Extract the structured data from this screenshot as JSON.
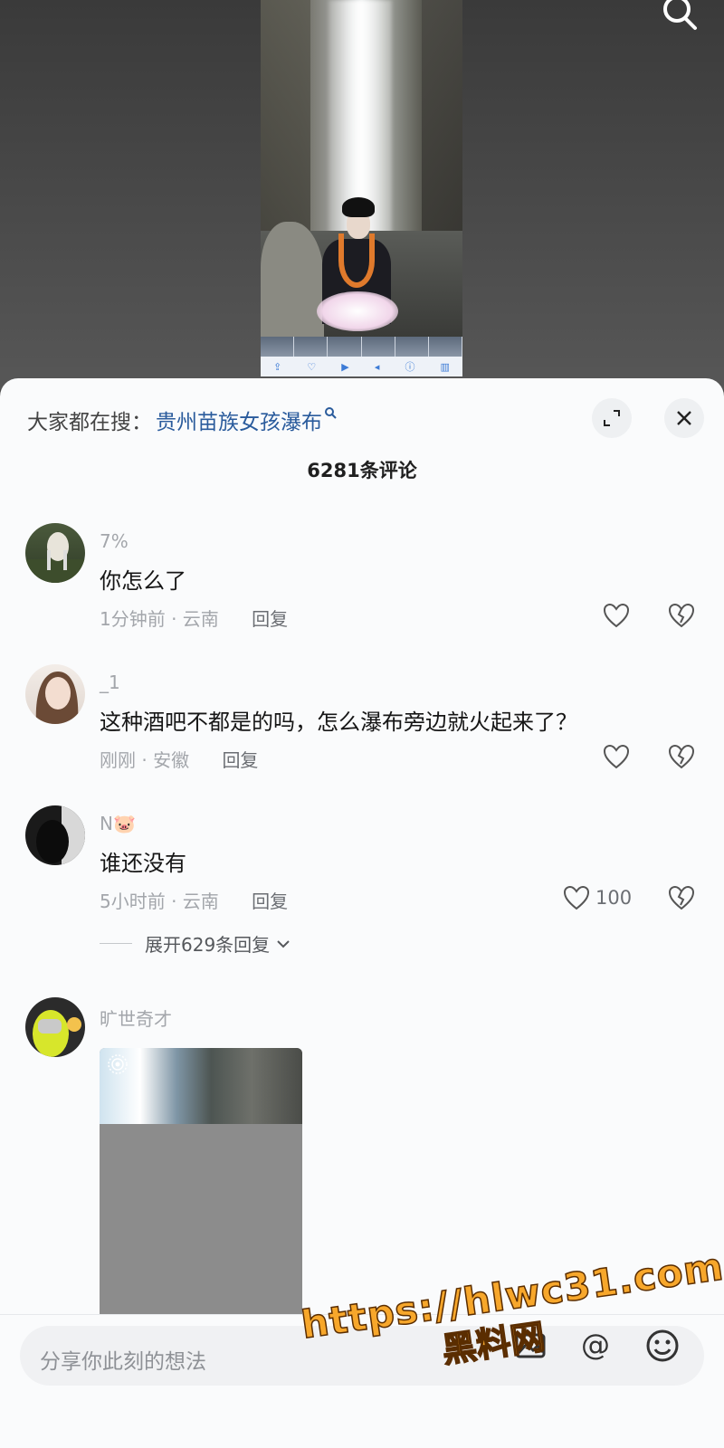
{
  "header": {
    "trending_prefix": "大家都在搜：",
    "trending_query": "贵州苗族女孩瀑布",
    "comment_count": "6281条评论"
  },
  "comments": [
    {
      "username": "7%",
      "text": "你怎么了",
      "meta": "1分钟前 · 云南",
      "reply_label": "回复",
      "likes": ""
    },
    {
      "username": "_1",
      "text": "这种酒吧不都是的吗，怎么瀑布旁边就火起来了？",
      "meta": "刚刚 · 安徽",
      "reply_label": "回复",
      "likes": ""
    },
    {
      "username": "N🐷",
      "text": "谁还没有",
      "meta": "5小时前 · 云南",
      "reply_label": "回复",
      "likes": "100",
      "expand_replies": "展开629条回复"
    },
    {
      "username": "旷世奇才",
      "text": "",
      "meta": "",
      "reply_label": "",
      "likes": ""
    }
  ],
  "composer": {
    "placeholder": "分享你此刻的想法"
  },
  "watermark": {
    "url": "https://hlwc31.com",
    "name": "黑料网"
  },
  "icons": {
    "top_search": "search-icon",
    "expand": "expand-icon",
    "close": "close-icon",
    "like": "heart-icon",
    "dislike": "broken-heart-icon",
    "image": "image-icon",
    "mention": "at-icon",
    "emoji": "emoji-icon"
  },
  "colors": {
    "link": "#2a5b9c",
    "sheet_bg": "#fafbfc",
    "watermark": "#f7a72b"
  }
}
